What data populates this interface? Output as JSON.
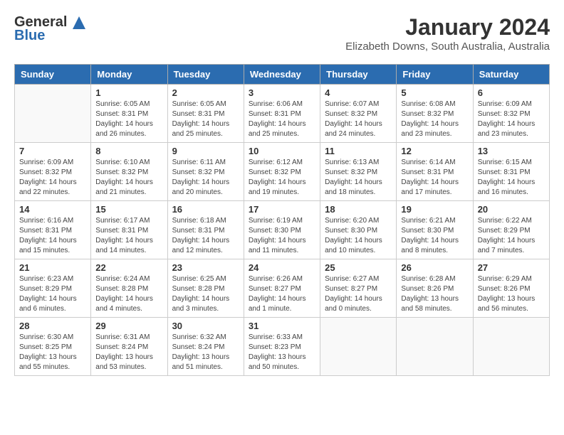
{
  "header": {
    "logo_line1": "General",
    "logo_line2": "Blue",
    "month": "January 2024",
    "location": "Elizabeth Downs, South Australia, Australia"
  },
  "weekdays": [
    "Sunday",
    "Monday",
    "Tuesday",
    "Wednesday",
    "Thursday",
    "Friday",
    "Saturday"
  ],
  "weeks": [
    [
      {
        "day": "",
        "sunrise": "",
        "sunset": "",
        "daylight": ""
      },
      {
        "day": "1",
        "sunrise": "Sunrise: 6:05 AM",
        "sunset": "Sunset: 8:31 PM",
        "daylight": "Daylight: 14 hours and 26 minutes."
      },
      {
        "day": "2",
        "sunrise": "Sunrise: 6:05 AM",
        "sunset": "Sunset: 8:31 PM",
        "daylight": "Daylight: 14 hours and 25 minutes."
      },
      {
        "day": "3",
        "sunrise": "Sunrise: 6:06 AM",
        "sunset": "Sunset: 8:31 PM",
        "daylight": "Daylight: 14 hours and 25 minutes."
      },
      {
        "day": "4",
        "sunrise": "Sunrise: 6:07 AM",
        "sunset": "Sunset: 8:32 PM",
        "daylight": "Daylight: 14 hours and 24 minutes."
      },
      {
        "day": "5",
        "sunrise": "Sunrise: 6:08 AM",
        "sunset": "Sunset: 8:32 PM",
        "daylight": "Daylight: 14 hours and 23 minutes."
      },
      {
        "day": "6",
        "sunrise": "Sunrise: 6:09 AM",
        "sunset": "Sunset: 8:32 PM",
        "daylight": "Daylight: 14 hours and 23 minutes."
      }
    ],
    [
      {
        "day": "7",
        "sunrise": "Sunrise: 6:09 AM",
        "sunset": "Sunset: 8:32 PM",
        "daylight": "Daylight: 14 hours and 22 minutes."
      },
      {
        "day": "8",
        "sunrise": "Sunrise: 6:10 AM",
        "sunset": "Sunset: 8:32 PM",
        "daylight": "Daylight: 14 hours and 21 minutes."
      },
      {
        "day": "9",
        "sunrise": "Sunrise: 6:11 AM",
        "sunset": "Sunset: 8:32 PM",
        "daylight": "Daylight: 14 hours and 20 minutes."
      },
      {
        "day": "10",
        "sunrise": "Sunrise: 6:12 AM",
        "sunset": "Sunset: 8:32 PM",
        "daylight": "Daylight: 14 hours and 19 minutes."
      },
      {
        "day": "11",
        "sunrise": "Sunrise: 6:13 AM",
        "sunset": "Sunset: 8:32 PM",
        "daylight": "Daylight: 14 hours and 18 minutes."
      },
      {
        "day": "12",
        "sunrise": "Sunrise: 6:14 AM",
        "sunset": "Sunset: 8:31 PM",
        "daylight": "Daylight: 14 hours and 17 minutes."
      },
      {
        "day": "13",
        "sunrise": "Sunrise: 6:15 AM",
        "sunset": "Sunset: 8:31 PM",
        "daylight": "Daylight: 14 hours and 16 minutes."
      }
    ],
    [
      {
        "day": "14",
        "sunrise": "Sunrise: 6:16 AM",
        "sunset": "Sunset: 8:31 PM",
        "daylight": "Daylight: 14 hours and 15 minutes."
      },
      {
        "day": "15",
        "sunrise": "Sunrise: 6:17 AM",
        "sunset": "Sunset: 8:31 PM",
        "daylight": "Daylight: 14 hours and 14 minutes."
      },
      {
        "day": "16",
        "sunrise": "Sunrise: 6:18 AM",
        "sunset": "Sunset: 8:31 PM",
        "daylight": "Daylight: 14 hours and 12 minutes."
      },
      {
        "day": "17",
        "sunrise": "Sunrise: 6:19 AM",
        "sunset": "Sunset: 8:30 PM",
        "daylight": "Daylight: 14 hours and 11 minutes."
      },
      {
        "day": "18",
        "sunrise": "Sunrise: 6:20 AM",
        "sunset": "Sunset: 8:30 PM",
        "daylight": "Daylight: 14 hours and 10 minutes."
      },
      {
        "day": "19",
        "sunrise": "Sunrise: 6:21 AM",
        "sunset": "Sunset: 8:30 PM",
        "daylight": "Daylight: 14 hours and 8 minutes."
      },
      {
        "day": "20",
        "sunrise": "Sunrise: 6:22 AM",
        "sunset": "Sunset: 8:29 PM",
        "daylight": "Daylight: 14 hours and 7 minutes."
      }
    ],
    [
      {
        "day": "21",
        "sunrise": "Sunrise: 6:23 AM",
        "sunset": "Sunset: 8:29 PM",
        "daylight": "Daylight: 14 hours and 6 minutes."
      },
      {
        "day": "22",
        "sunrise": "Sunrise: 6:24 AM",
        "sunset": "Sunset: 8:28 PM",
        "daylight": "Daylight: 14 hours and 4 minutes."
      },
      {
        "day": "23",
        "sunrise": "Sunrise: 6:25 AM",
        "sunset": "Sunset: 8:28 PM",
        "daylight": "Daylight: 14 hours and 3 minutes."
      },
      {
        "day": "24",
        "sunrise": "Sunrise: 6:26 AM",
        "sunset": "Sunset: 8:27 PM",
        "daylight": "Daylight: 14 hours and 1 minute."
      },
      {
        "day": "25",
        "sunrise": "Sunrise: 6:27 AM",
        "sunset": "Sunset: 8:27 PM",
        "daylight": "Daylight: 14 hours and 0 minutes."
      },
      {
        "day": "26",
        "sunrise": "Sunrise: 6:28 AM",
        "sunset": "Sunset: 8:26 PM",
        "daylight": "Daylight: 13 hours and 58 minutes."
      },
      {
        "day": "27",
        "sunrise": "Sunrise: 6:29 AM",
        "sunset": "Sunset: 8:26 PM",
        "daylight": "Daylight: 13 hours and 56 minutes."
      }
    ],
    [
      {
        "day": "28",
        "sunrise": "Sunrise: 6:30 AM",
        "sunset": "Sunset: 8:25 PM",
        "daylight": "Daylight: 13 hours and 55 minutes."
      },
      {
        "day": "29",
        "sunrise": "Sunrise: 6:31 AM",
        "sunset": "Sunset: 8:24 PM",
        "daylight": "Daylight: 13 hours and 53 minutes."
      },
      {
        "day": "30",
        "sunrise": "Sunrise: 6:32 AM",
        "sunset": "Sunset: 8:24 PM",
        "daylight": "Daylight: 13 hours and 51 minutes."
      },
      {
        "day": "31",
        "sunrise": "Sunrise: 6:33 AM",
        "sunset": "Sunset: 8:23 PM",
        "daylight": "Daylight: 13 hours and 50 minutes."
      },
      {
        "day": "",
        "sunrise": "",
        "sunset": "",
        "daylight": ""
      },
      {
        "day": "",
        "sunrise": "",
        "sunset": "",
        "daylight": ""
      },
      {
        "day": "",
        "sunrise": "",
        "sunset": "",
        "daylight": ""
      }
    ]
  ]
}
